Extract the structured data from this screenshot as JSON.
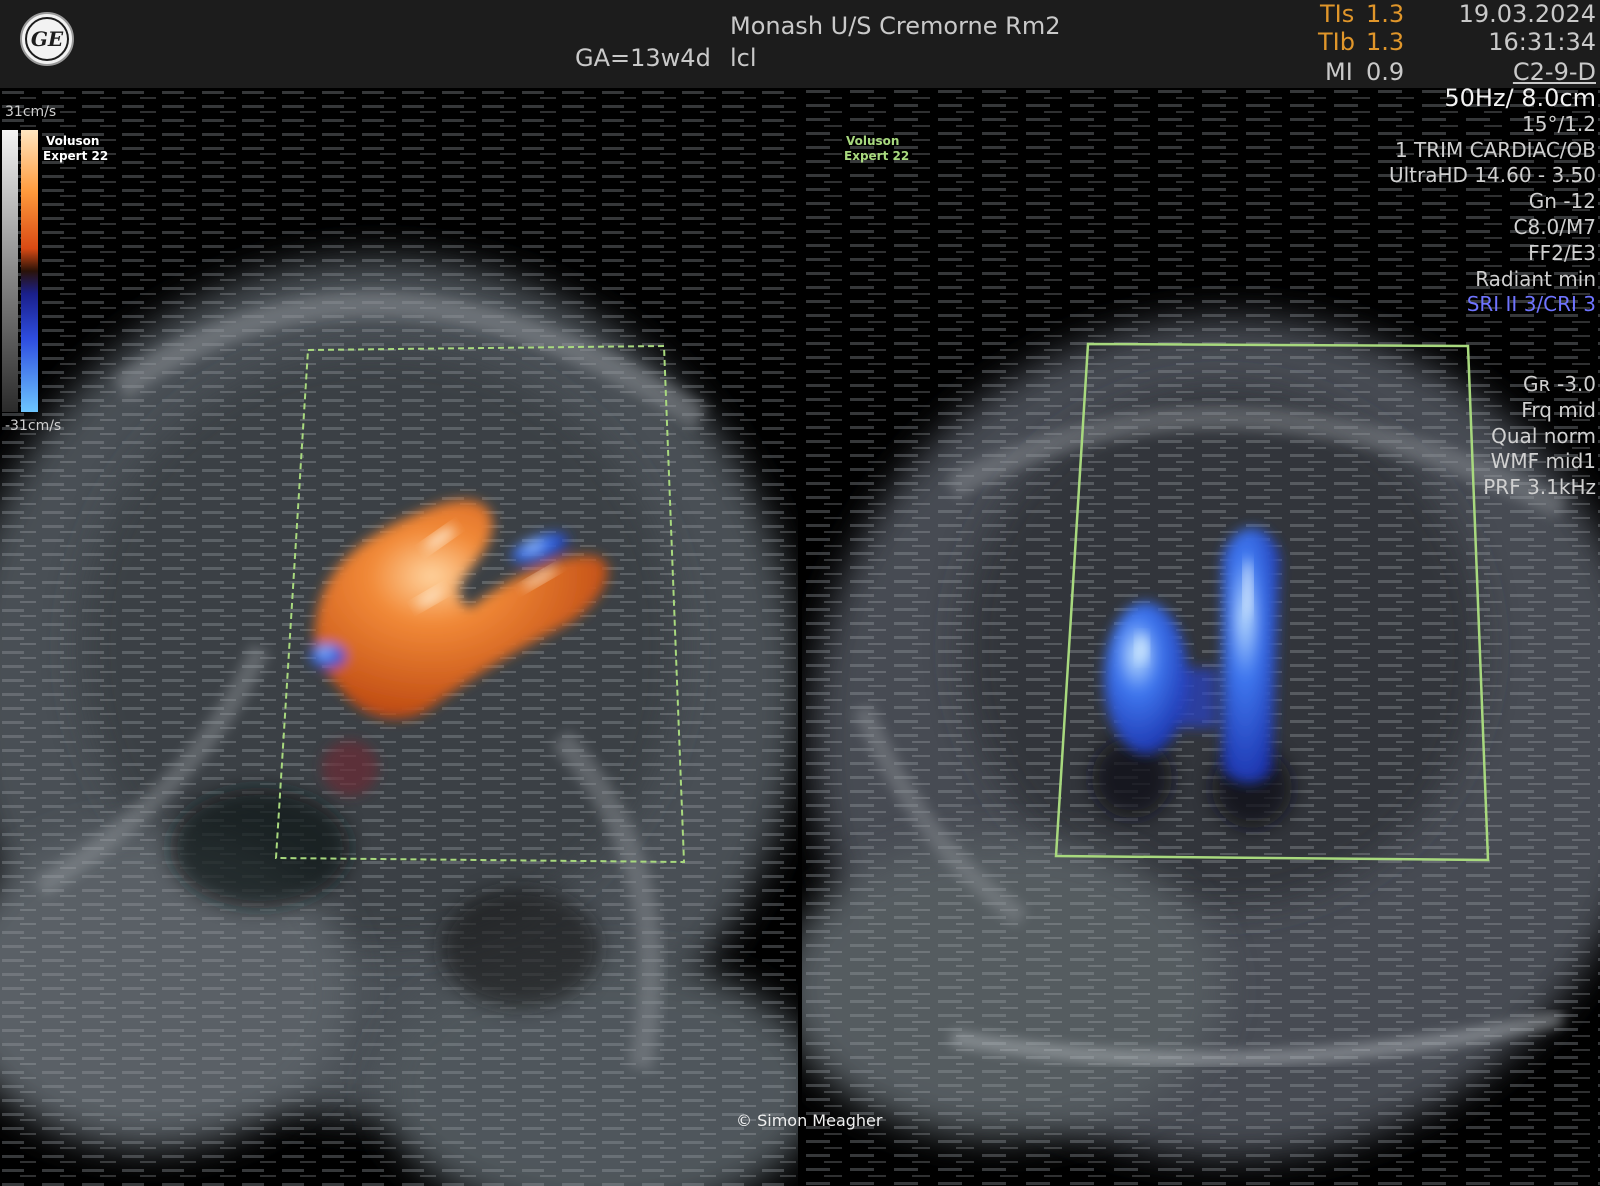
{
  "header": {
    "logo_text": "GE",
    "gestational_age": "GA=13w4d",
    "site": "Monash U/S Cremorne Rm2",
    "operator": "lcl",
    "tis_label": "TIs",
    "tis_value": "1.3",
    "tib_label": "TIb",
    "tib_value": "1.3",
    "mi_label": "MI",
    "mi_value": "0.9",
    "date": "19.03.2024",
    "time": "16:31:34",
    "probe": "C2-9-D"
  },
  "parameters": {
    "frame_depth": "50Hz/ 8.0cm",
    "angle": "15°/1.2",
    "preset": "1 TRIM CARDIAC/OB",
    "ultrahd": "UltraHD 14.60 - 3.50",
    "gain": "Gn -12",
    "compression": "C8.0/M7",
    "ff": "FF2/E3",
    "radiant": "Radiant min",
    "sri": "SRI II 3/CRI 3"
  },
  "color_parameters": {
    "color_gain": "Gʀ -3.0",
    "frequency": "Frq mid",
    "quality": "Qual norm",
    "wmf": "WMF mid1",
    "prf": "PRF  3.1kHz"
  },
  "velocity_scale": {
    "top": "31cm/s",
    "bottom": "-31cm/s"
  },
  "watermarks": {
    "left_line1": "Voluson",
    "left_line2": "Expert 22",
    "right_line1": "Voluson",
    "right_line2": "Expert 22"
  },
  "credit": "© Simon Meagher",
  "colors": {
    "header_bg": "#1c1c1c",
    "ti_orange": "#e0962a",
    "sri_blue": "#6f74ff",
    "flow_orange": "#e8702a",
    "flow_blue": "#2e5be8",
    "roi_box": "#a8d97e"
  },
  "icons": [
    "ge-logo-icon",
    "color-velocity-scale-bar"
  ]
}
